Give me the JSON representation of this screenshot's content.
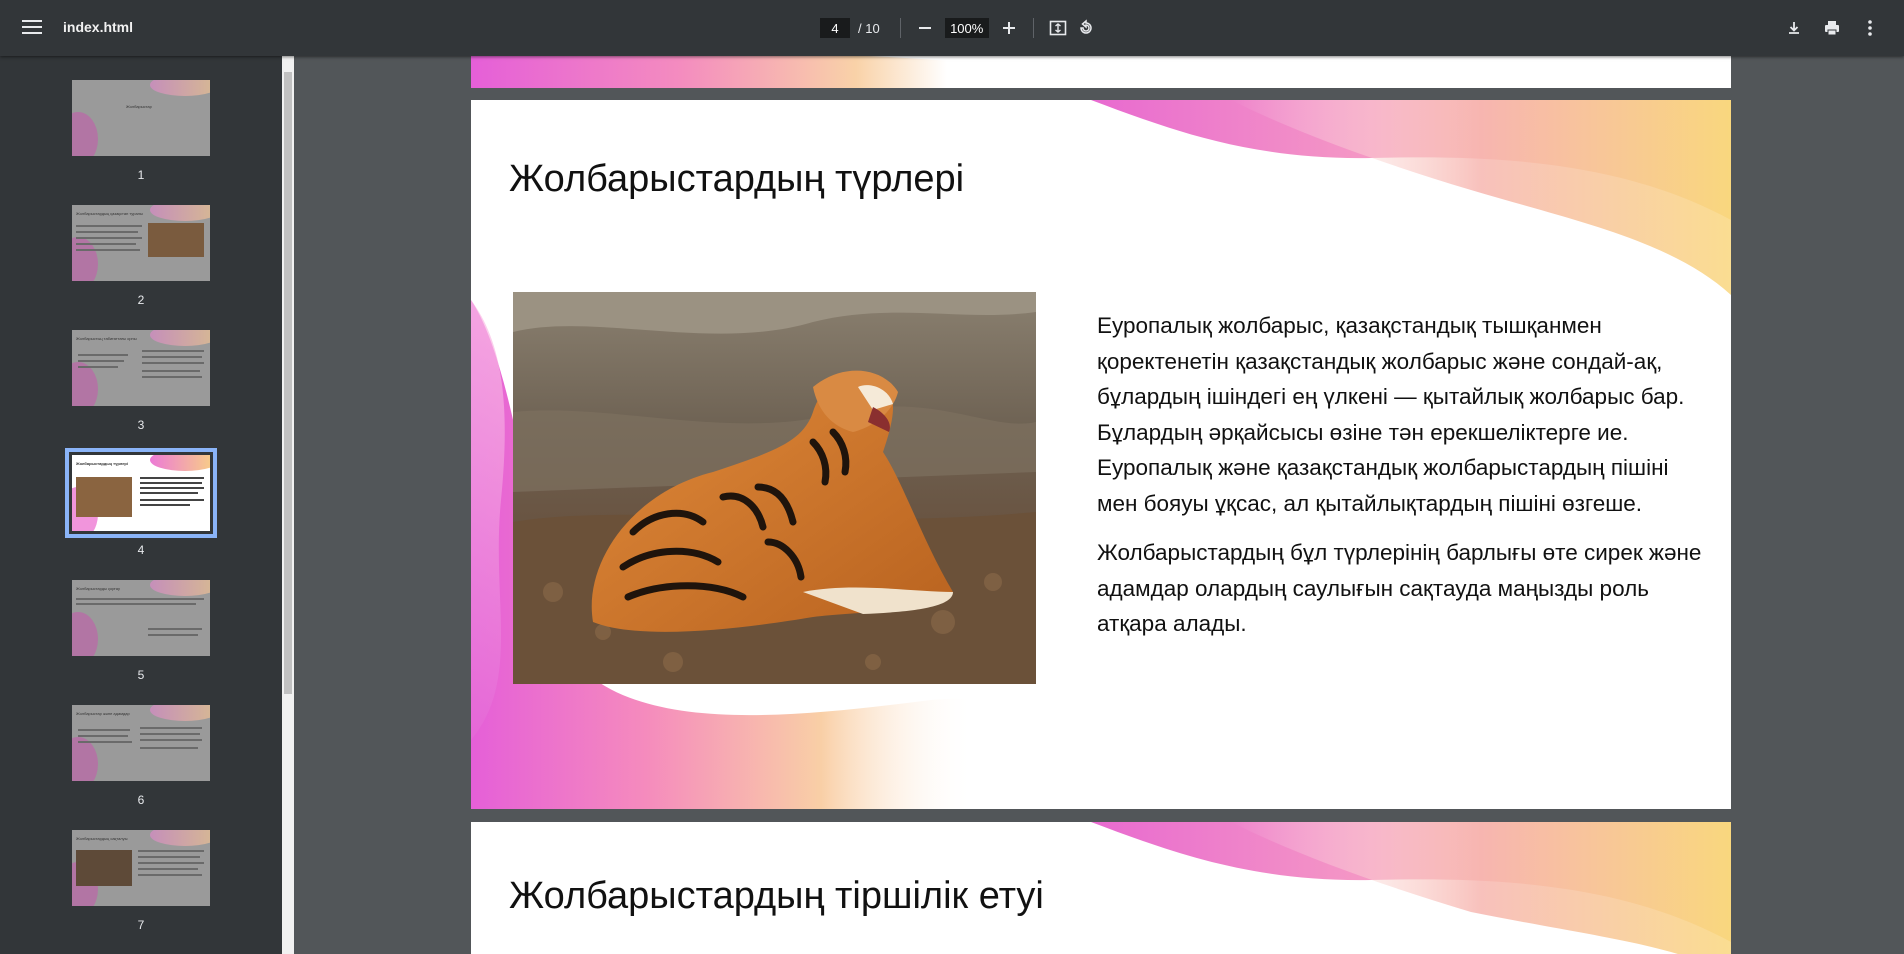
{
  "toolbar": {
    "file_name": "index.html",
    "current_page": "4",
    "total_pages": "/ 10",
    "zoom": "100%",
    "minus_label": "−",
    "plus_label": "+"
  },
  "thumbnails": [
    {
      "number": "1",
      "title": "Жолбарыстар"
    },
    {
      "number": "2",
      "title": "Жолбарыстардың қазақстан туралы"
    },
    {
      "number": "3",
      "title": "Жолбарыстың табиғаттағы орны"
    },
    {
      "number": "4",
      "title": "Жолбарыстардың түрлері"
    },
    {
      "number": "5",
      "title": "Жолбарыстарды қорғау"
    },
    {
      "number": "6",
      "title": "Жолбарыстар және адамдар"
    },
    {
      "number": "7",
      "title": "Жолбарыстардың сақталуы"
    }
  ],
  "slides": {
    "current": {
      "title": "Жолбарыстардың түрлері",
      "paragraph1": "Еуропалық жолбарыс, қазақстандық тышқанмен қоректенетін қазақстандық жолбарыс және сондай-ақ, бұлардың ішіндегі ең үлкені — қытайлық жолбарыс бар. Бұлардың әрқайсысы өзіне тән ерекшеліктерге ие. Еуропалық және қазақстандық жолбарыстардың пішіні мен бояуы ұқсас, ал қытайлықтардың пішіні өзгеше.",
      "paragraph2": "Жолбарыстардың бұл түрлерінің барлығы өте сирек және адамдар олардың саулығын сақтауда маңызды роль атқара алады."
    },
    "next": {
      "title": "Жолбарыстардың тіршілік етуі"
    }
  },
  "colors": {
    "toolbar_bg": "#323639",
    "viewer_bg": "#525659",
    "accent_pink": "#e86ad0",
    "accent_peach": "#f8c2a0",
    "accent_yellow": "#f9d77e",
    "active_thumb_border": "#8ab4f8"
  },
  "icons": [
    "menu-icon",
    "minus-icon",
    "plus-icon",
    "fit-page-icon",
    "rotate-icon",
    "download-icon",
    "print-icon",
    "more-icon"
  ]
}
